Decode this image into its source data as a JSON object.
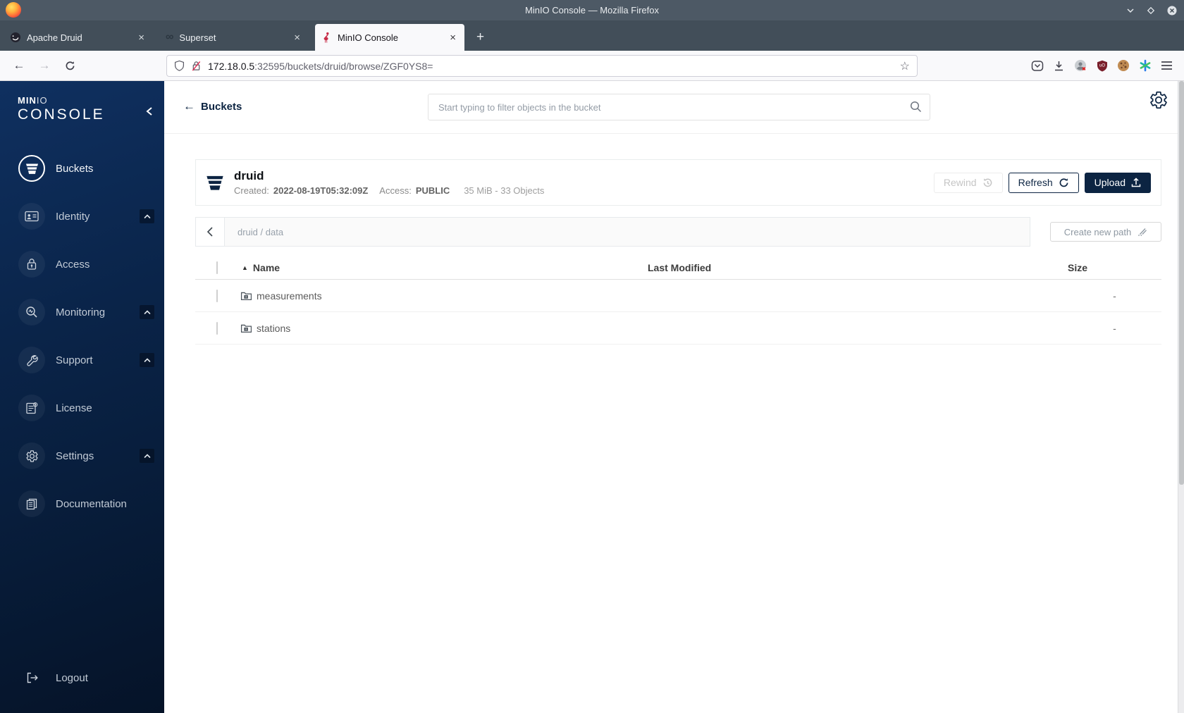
{
  "window": {
    "title": "MinIO Console — Mozilla Firefox"
  },
  "tabs": [
    {
      "label": "Apache Druid"
    },
    {
      "label": "Superset"
    },
    {
      "label": "MinIO Console"
    }
  ],
  "toolbar": {
    "url_host": "172.18.0.5",
    "url_rest": ":32595/buckets/druid/browse/ZGF0YS8="
  },
  "glyphs": {
    "infinity": "∞",
    "back_arrow": "←",
    "forward_arrow": "→",
    "star": "☆",
    "close_tab": "×",
    "new_tab": "+",
    "sort_asc": "▲",
    "left_arrow": "←"
  },
  "sidebar": {
    "logo_min": "MIN",
    "logo_io": "IO",
    "logo_console": "CONSOLE",
    "items": [
      {
        "label": "Buckets"
      },
      {
        "label": "Identity"
      },
      {
        "label": "Access"
      },
      {
        "label": "Monitoring"
      },
      {
        "label": "Support"
      },
      {
        "label": "License"
      },
      {
        "label": "Settings"
      },
      {
        "label": "Documentation"
      }
    ],
    "logout_label": "Logout"
  },
  "main": {
    "back_label": "Buckets",
    "search_placeholder": "Start typing to filter objects in the bucket",
    "bucket": {
      "name": "druid",
      "created_label": "Created:",
      "created_value": "2022-08-19T05:32:09Z",
      "access_label": "Access:",
      "access_value": "PUBLIC",
      "summary": "35 MiB - 33 Objects",
      "rewind_label": "Rewind",
      "refresh_label": "Refresh",
      "upload_label": "Upload"
    },
    "path": {
      "breadcrumb": "druid / data",
      "create_button": "Create new path"
    },
    "table": {
      "headers": [
        "Name",
        "Last Modified",
        "Size"
      ],
      "rows": [
        {
          "name": "measurements",
          "last_modified": "",
          "size": "-"
        },
        {
          "name": "stations",
          "last_modified": "",
          "size": "-"
        }
      ]
    }
  },
  "colors": {
    "accent_navy": "#0c2442",
    "minio_red": "#c72c48",
    "titlebar": "#4d5965"
  }
}
